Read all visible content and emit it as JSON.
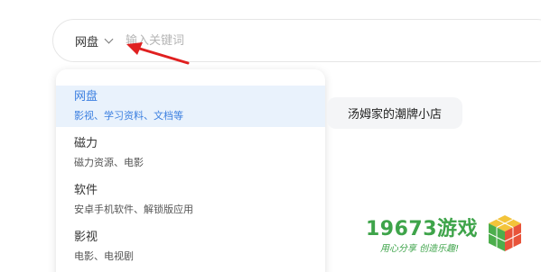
{
  "search": {
    "category_label": "网盘",
    "placeholder": "输入关键词"
  },
  "dropdown": {
    "items": [
      {
        "title": "网盘",
        "desc": "影视、学习资料、文档等",
        "active": true
      },
      {
        "title": "磁力",
        "desc": "磁力资源、电影",
        "active": false
      },
      {
        "title": "软件",
        "desc": "安卓手机软件、解锁版应用",
        "active": false
      },
      {
        "title": "影视",
        "desc": "电影、电视剧",
        "active": false
      }
    ]
  },
  "tag": {
    "label": "汤姆家的潮牌小店"
  },
  "watermark": {
    "brand": "19673游戏",
    "slogan": "用心分享 创造乐趣!"
  },
  "colors": {
    "accent": "#3b7fe0",
    "active_bg": "#e9f2fc",
    "annotation_arrow": "#e02020",
    "watermark_green": "#3ea44a"
  }
}
